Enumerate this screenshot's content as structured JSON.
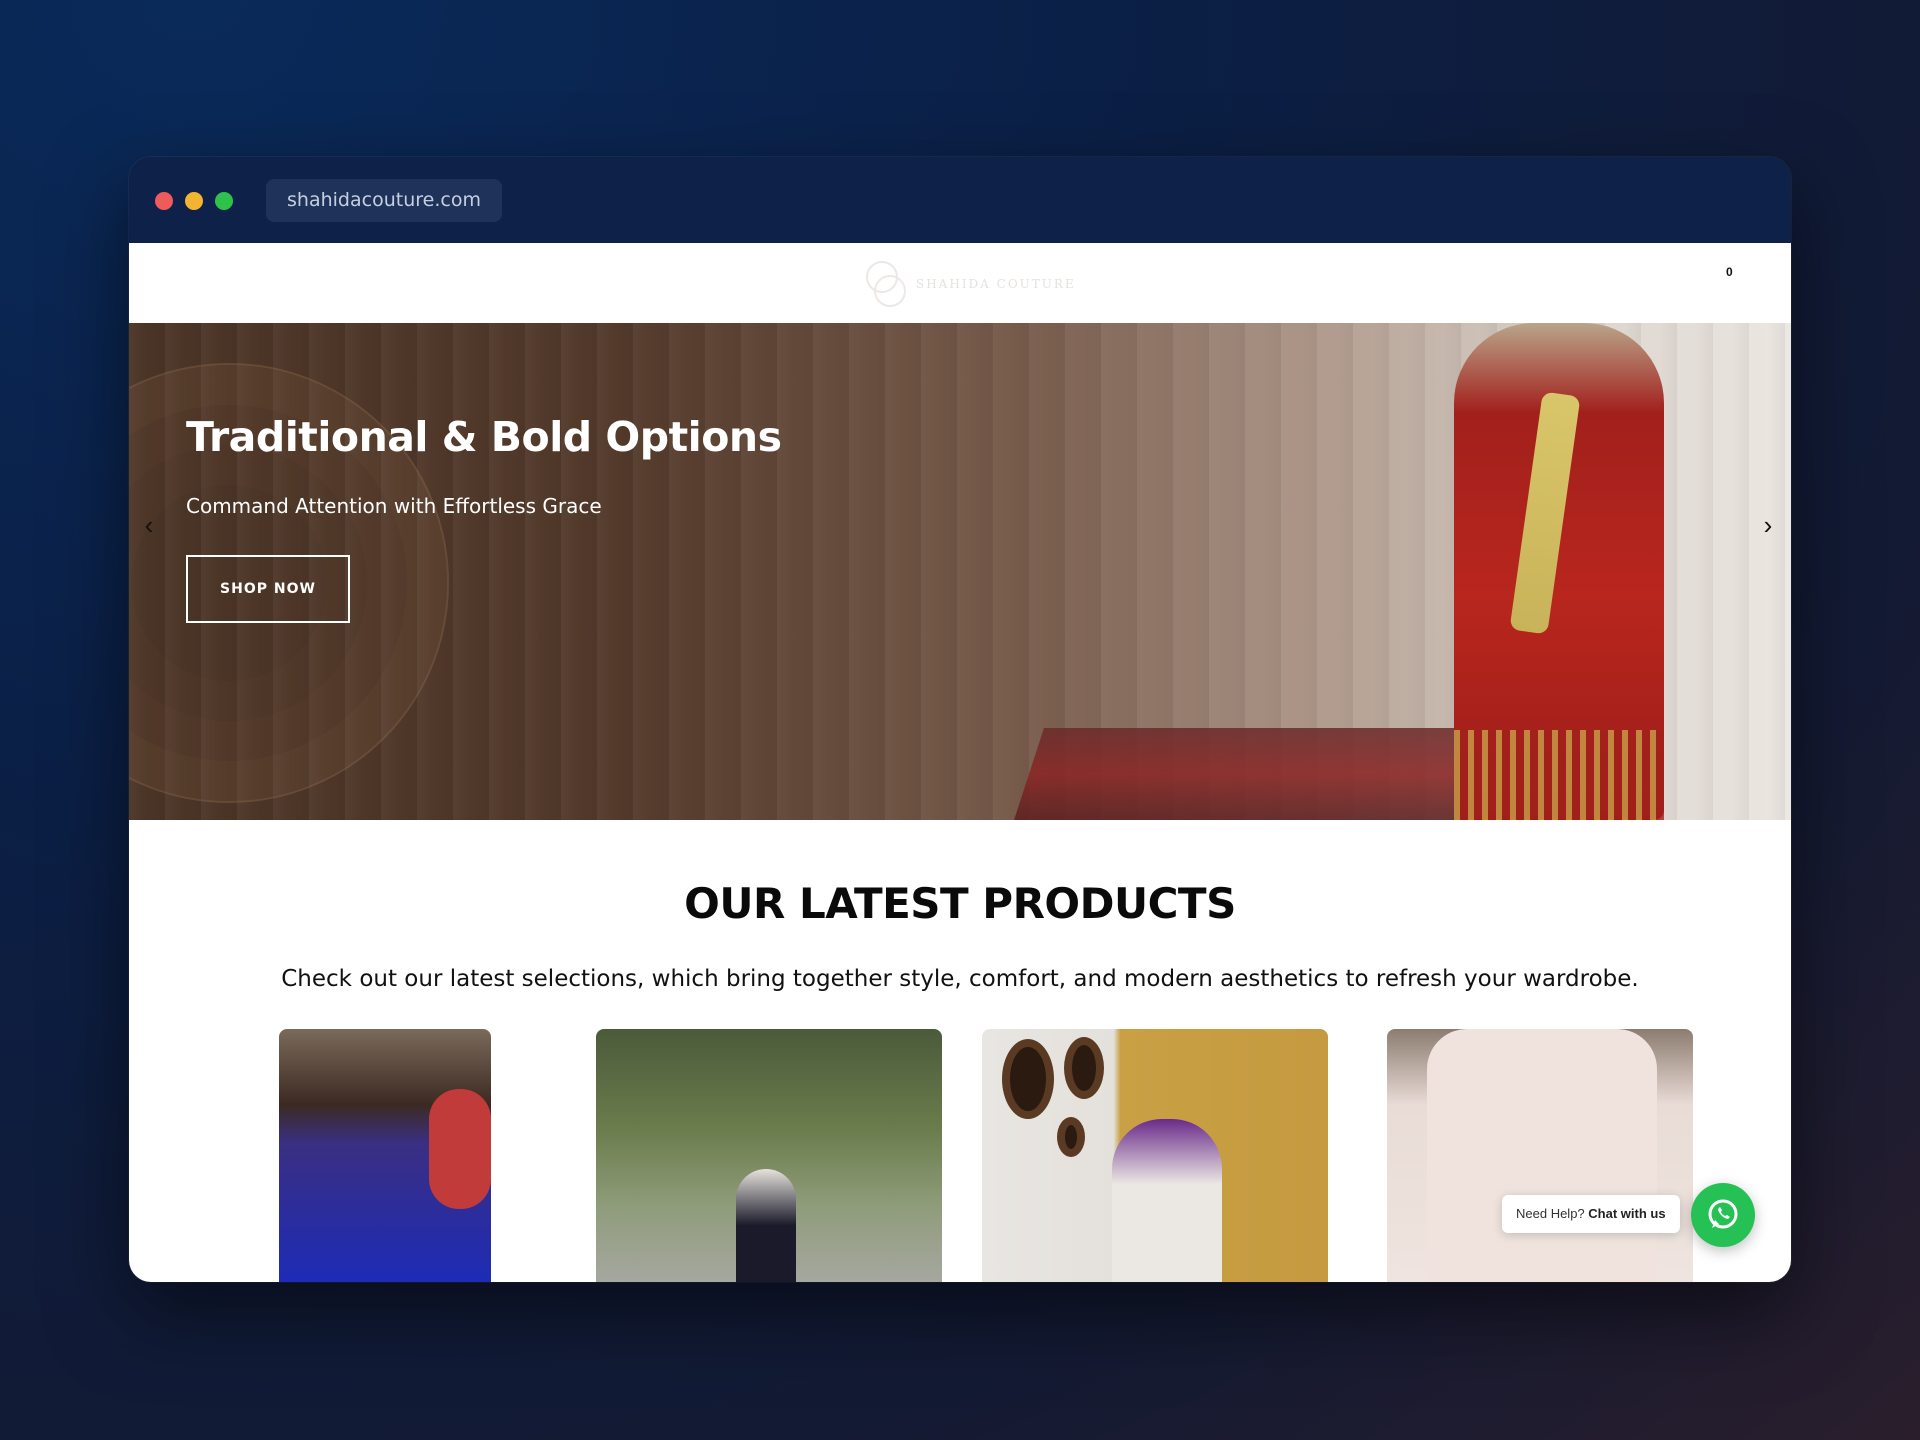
{
  "browser": {
    "url": "shahidacouture.com"
  },
  "header": {
    "logo_text": "SHAHIDA COUTURE",
    "cart_count": "0"
  },
  "hero": {
    "title": "Traditional & Bold Options",
    "subtitle": "Command Attention with Effortless Grace",
    "button_label": "SHOP NOW",
    "prev_arrow": "‹",
    "next_arrow": "›"
  },
  "products": {
    "title": "OUR LATEST PRODUCTS",
    "description": "Check out our latest selections, which bring together style, comfort, and modern aesthetics to refresh your wardrobe."
  },
  "chat": {
    "prefix": "Need Help?",
    "cta": "Chat with us",
    "icon": "whatsapp-icon"
  },
  "colors": {
    "browser_chrome": "#0e2148",
    "whatsapp_green": "#25c154",
    "hero_brown": "#4a3426"
  }
}
